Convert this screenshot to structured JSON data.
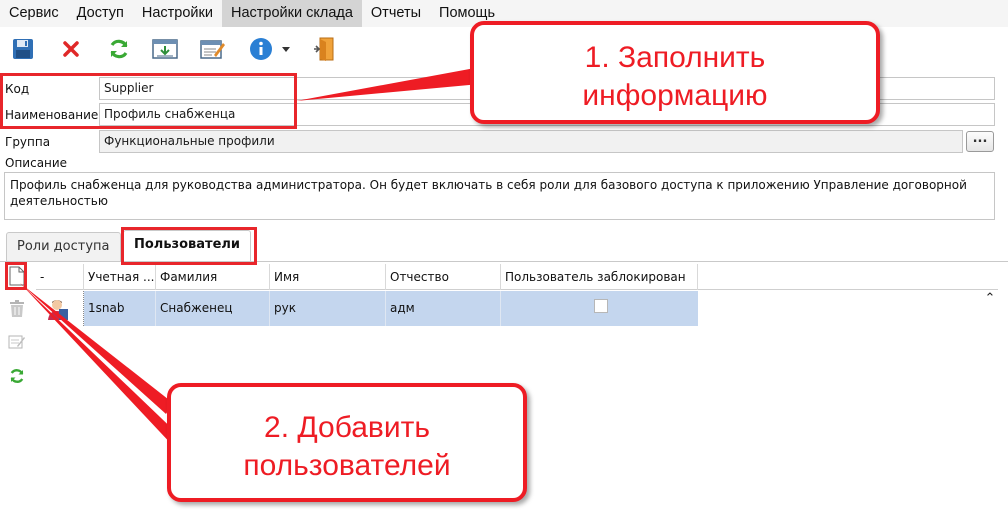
{
  "menu": [
    "Сервис",
    "Доступ",
    "Настройки",
    "Настройки склада",
    "Отчеты",
    "Помощь"
  ],
  "toolbar": {
    "icons": [
      "save-icon",
      "delete-icon",
      "refresh-icon",
      "import-icon",
      "edit-icon",
      "info-icon",
      "dropdown-icon",
      "exit-icon"
    ]
  },
  "form": {
    "code_label": "Код",
    "code_value": "Supplier",
    "name_label": "Наименование",
    "name_value": "Профиль снабженца",
    "group_label": "Группа",
    "group_value": "Функциональные профили",
    "group_button": "...",
    "desc_label": "Описание",
    "desc_value": "Профиль снабженца для руководства администратора. Он будет включать в себя роли для базового доступа к приложению Управление договорной деятельностью"
  },
  "tabs": [
    "Роли доступа",
    "Пользователи"
  ],
  "grid": {
    "headers": [
      "-",
      "Учетная ...",
      "Фамилия",
      "Имя",
      "Отчество",
      "Пользователь заблокирован"
    ],
    "rows": [
      {
        "account": "1snab",
        "last_name": "Снабженец",
        "first_name": "рук",
        "middle_name": "адм",
        "blocked": false
      }
    ]
  },
  "callouts": {
    "one": "1. Заполнить информацию",
    "two": "2. Добавить пользователей"
  },
  "colors": {
    "annotation": "#ee1c24",
    "selection": "#c4d6ee"
  }
}
